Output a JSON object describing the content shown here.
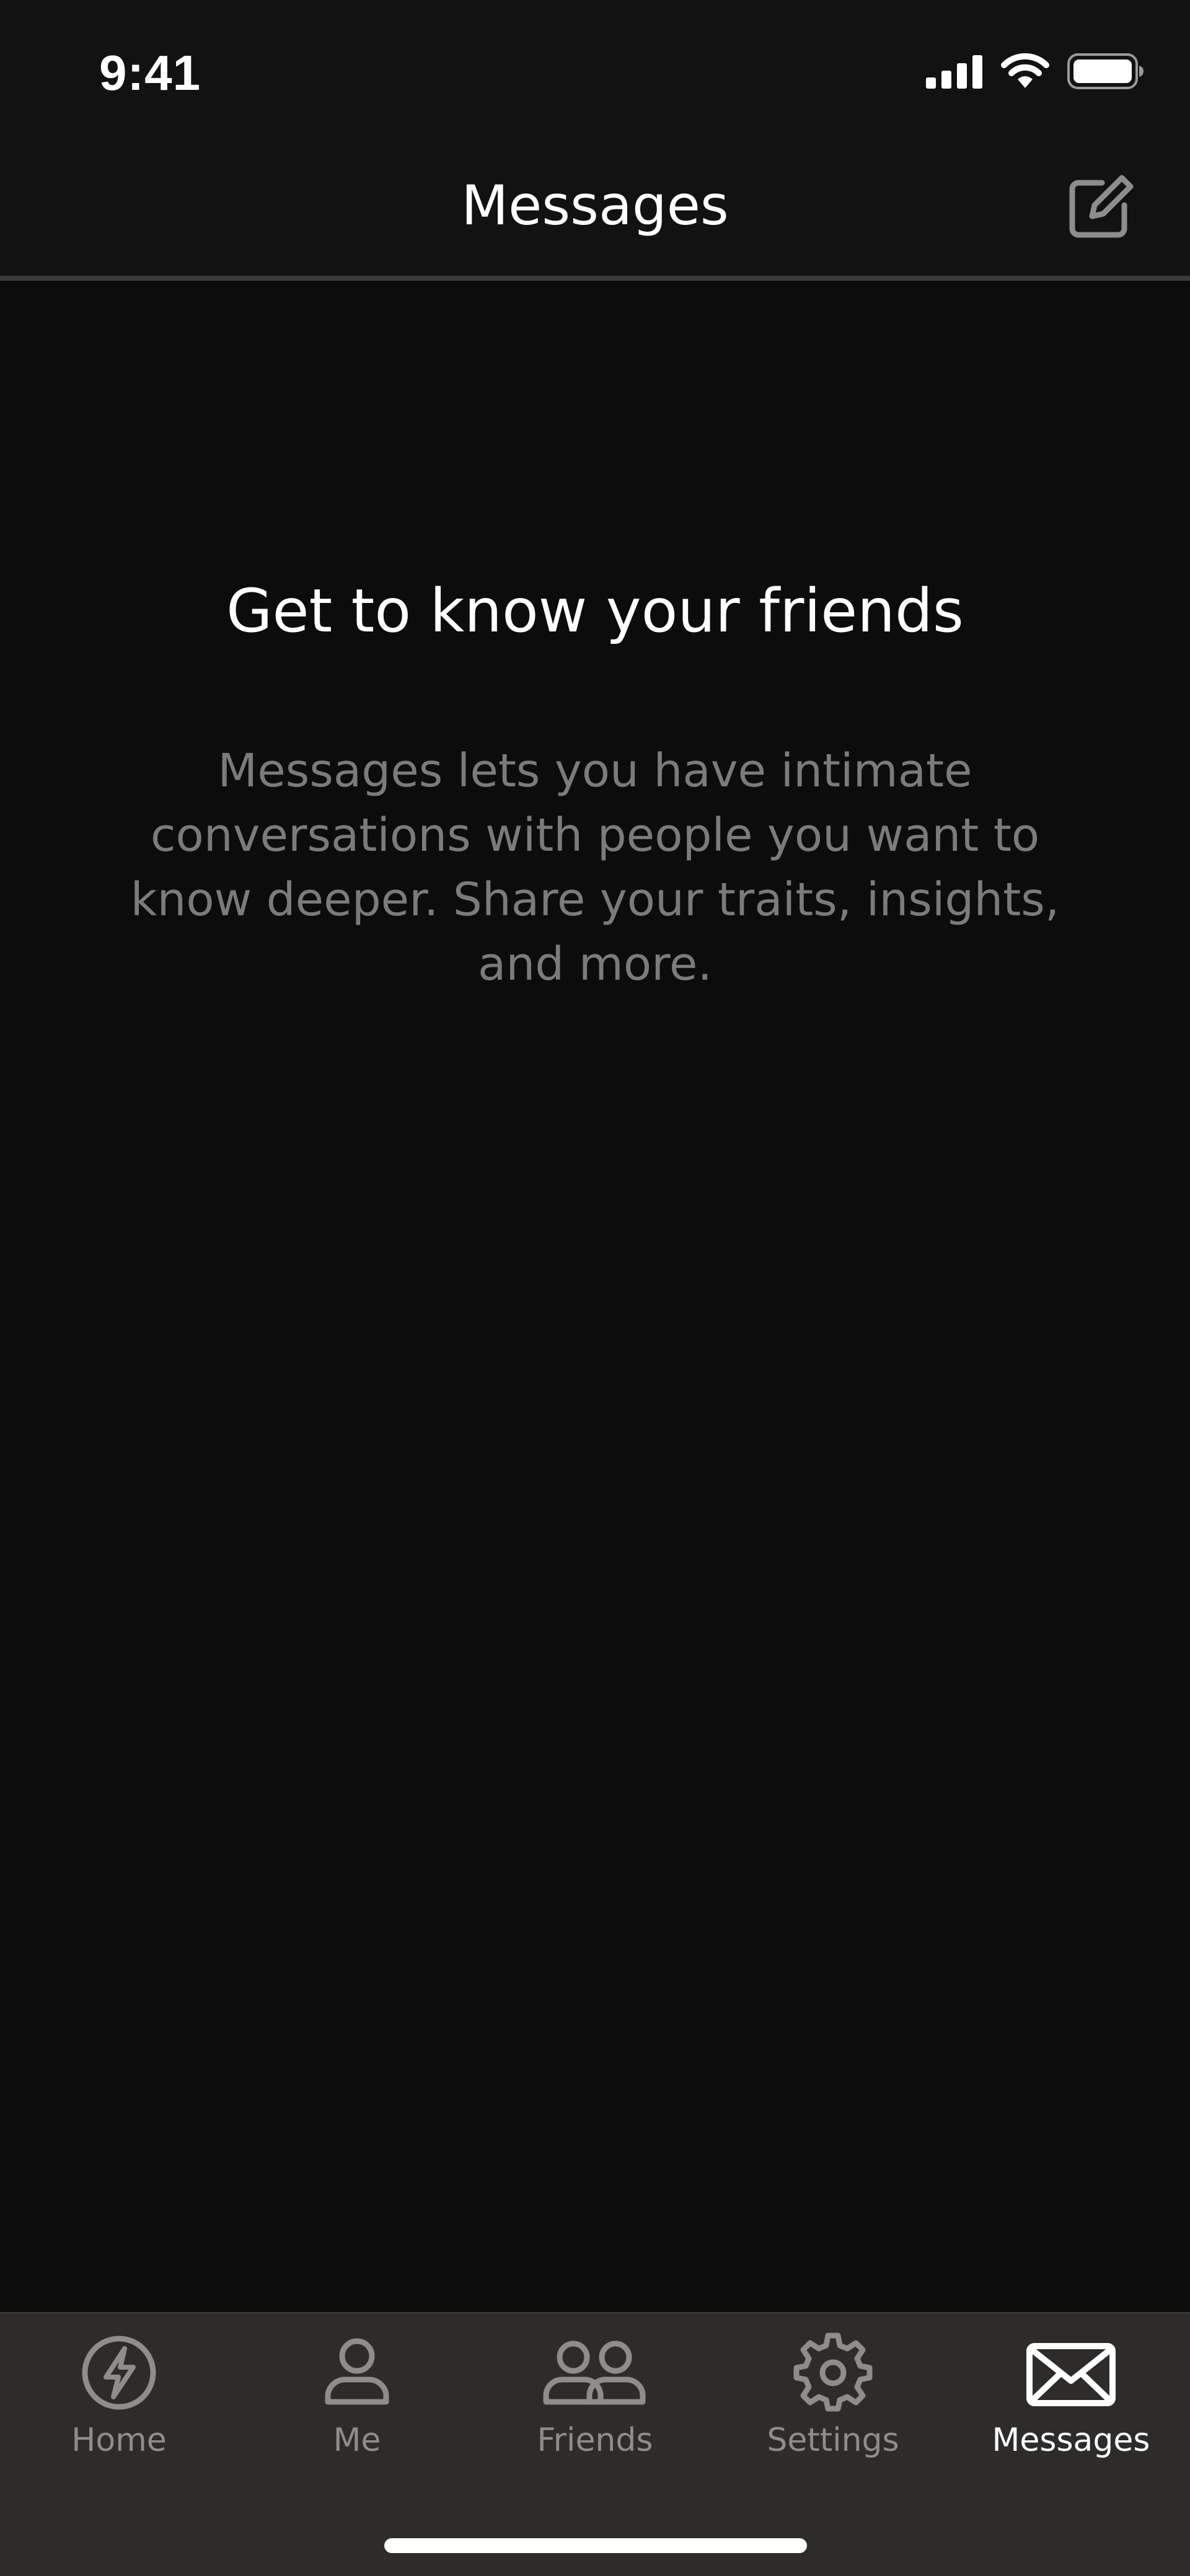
{
  "status_bar": {
    "time": "9:41",
    "icons": [
      "cellular-signal-icon",
      "wifi-icon",
      "battery-icon"
    ]
  },
  "header": {
    "title": "Messages",
    "compose_icon": "compose-icon"
  },
  "empty_state": {
    "title": "Get to know your friends",
    "body": "Messages lets you have intimate conversations with people you want to know deeper. Share your traits, insights, and more."
  },
  "tabbar": {
    "items": [
      {
        "label": "Home",
        "icon": "lightning-icon",
        "active": false
      },
      {
        "label": "Me",
        "icon": "person-icon",
        "active": false
      },
      {
        "label": "Friends",
        "icon": "people-icon",
        "active": false
      },
      {
        "label": "Settings",
        "icon": "gear-icon",
        "active": false
      },
      {
        "label": "Messages",
        "icon": "envelope-icon",
        "active": true
      }
    ]
  },
  "colors": {
    "background": "#0c0c0c",
    "header": "#121212",
    "tabbar": "#2e2c2b",
    "inactive": "#8f8d8b",
    "active": "#ffffff",
    "body_text": "#7b7b7b"
  }
}
